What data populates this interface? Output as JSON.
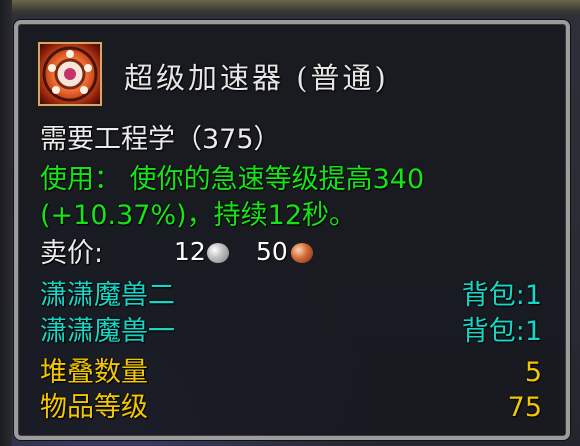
{
  "item": {
    "icon": "gear-explosion-icon",
    "name": "超级加速器 (普通)",
    "requirement": "需要工程学（375）",
    "use_line1": "使用： 使你的急速等级提高340",
    "use_line2": "(+10.37%)，持续12秒。",
    "sell_label": "卖价:",
    "sell_silver": "12",
    "sell_copper": "50"
  },
  "bags": [
    {
      "character": "潇潇魔兽二",
      "location": "背包:1"
    },
    {
      "character": "潇潇魔兽一",
      "location": "背包:1"
    }
  ],
  "stats": [
    {
      "label": "堆叠数量",
      "value": "5"
    },
    {
      "label": "物品等级",
      "value": "75"
    }
  ],
  "colors": {
    "title": "#e6e6e6",
    "use_text": "#16e416",
    "bag_text": "#18d6c6",
    "stat_text": "#f2c600",
    "border": "#9c9c9c"
  }
}
